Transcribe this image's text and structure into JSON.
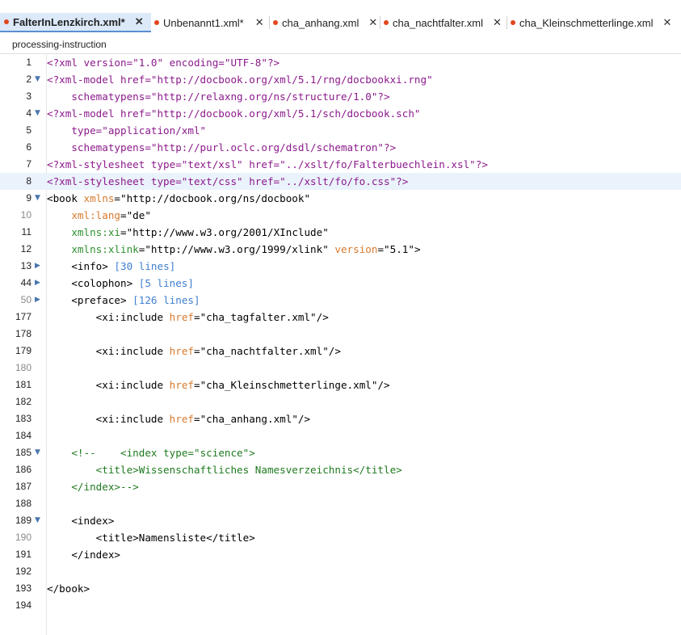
{
  "tabs": [
    {
      "label": "FalterInLenzkirch.xml*",
      "close": "✕"
    },
    {
      "label": "Unbenannt1.xml*",
      "close": "✕"
    },
    {
      "label": "cha_anhang.xml",
      "close": "✕"
    },
    {
      "label": "cha_nachtfalter.xml",
      "close": "✕"
    },
    {
      "label": "cha_Kleinschmetterlinge.xml",
      "close": "✕"
    }
  ],
  "breadcrumb": "processing-instruction",
  "lines": [
    {
      "n": "1"
    },
    {
      "n": "2"
    },
    {
      "n": "3"
    },
    {
      "n": "4"
    },
    {
      "n": "5"
    },
    {
      "n": "6"
    },
    {
      "n": "7"
    },
    {
      "n": "8"
    },
    {
      "n": "9"
    },
    {
      "n": "10"
    },
    {
      "n": "11"
    },
    {
      "n": "12"
    },
    {
      "n": "13"
    },
    {
      "n": "44"
    },
    {
      "n": "50"
    },
    {
      "n": "177"
    },
    {
      "n": "178"
    },
    {
      "n": "179"
    },
    {
      "n": "180"
    },
    {
      "n": "181"
    },
    {
      "n": "182"
    },
    {
      "n": "183"
    },
    {
      "n": "184"
    },
    {
      "n": "185"
    },
    {
      "n": "186"
    },
    {
      "n": "187"
    },
    {
      "n": "188"
    },
    {
      "n": "189"
    },
    {
      "n": "190"
    },
    {
      "n": "191"
    },
    {
      "n": "192"
    },
    {
      "n": "193"
    },
    {
      "n": "194"
    }
  ],
  "code": {
    "l1": "<?xml version=\"1.0\" encoding=\"UTF-8\"?>",
    "l2": "<?xml-model href=\"http://docbook.org/xml/5.1/rng/docbookxi.rng\"",
    "l3": "    schematypens=\"http://relaxng.org/ns/structure/1.0\"?>",
    "l4": "<?xml-model href=\"http://docbook.org/xml/5.1/sch/docbook.sch\"",
    "l5": "    type=\"application/xml\"",
    "l6": "    schematypens=\"http://purl.oclc.org/dsdl/schematron\"?>",
    "l7": "<?xml-stylesheet type=\"text/xsl\" href=\"../xslt/fo/Falterbuechlein.xsl\"?>",
    "l8": "<?xml-stylesheet type=\"text/css\" href=\"../xslt/fo/fo.css\"?>",
    "l9a": "<book ",
    "l9b": "xmlns",
    "l9c": "=\"http://docbook.org/ns/docbook\"",
    "l10a": "    ",
    "l10b": "xml:lang",
    "l10c": "=\"de\"",
    "l11a": "    ",
    "l11b": "xmlns:xi",
    "l11c": "=\"http://www.w3.org/2001/XInclude\"",
    "l12a": "    ",
    "l12b": "xmlns:xlink",
    "l12c": "=\"http://www.w3.org/1999/xlink\" ",
    "l12d": "version",
    "l12e": "=\"5.1\">",
    "l13a": "    <info> ",
    "l13b": "[30 lines]",
    "l44a": "    <colophon> ",
    "l44b": "[5 lines]",
    "l50a": "    <preface> ",
    "l50b": "[126 lines]",
    "inc1a": "        <xi:include ",
    "inc_href": "href",
    "inc1c": "=\"cha_tagfalter.xml\"/>",
    "inc2c": "=\"cha_nachtfalter.xml\"/>",
    "inc3c": "=\"cha_Kleinschmetterlinge.xml\"/>",
    "inc4c": "=\"cha_anhang.xml\"/>",
    "l185a": "    <!--    ",
    "l185b": "<index type=\"science\">",
    "l186": "        <title>Wissenschaftliches Namesverzeichnis</title>",
    "l187": "    </index>-->",
    "l189": "    <index>",
    "l190": "        <title>Namensliste</title>",
    "l191": "    </index>",
    "l193": "</book>"
  }
}
